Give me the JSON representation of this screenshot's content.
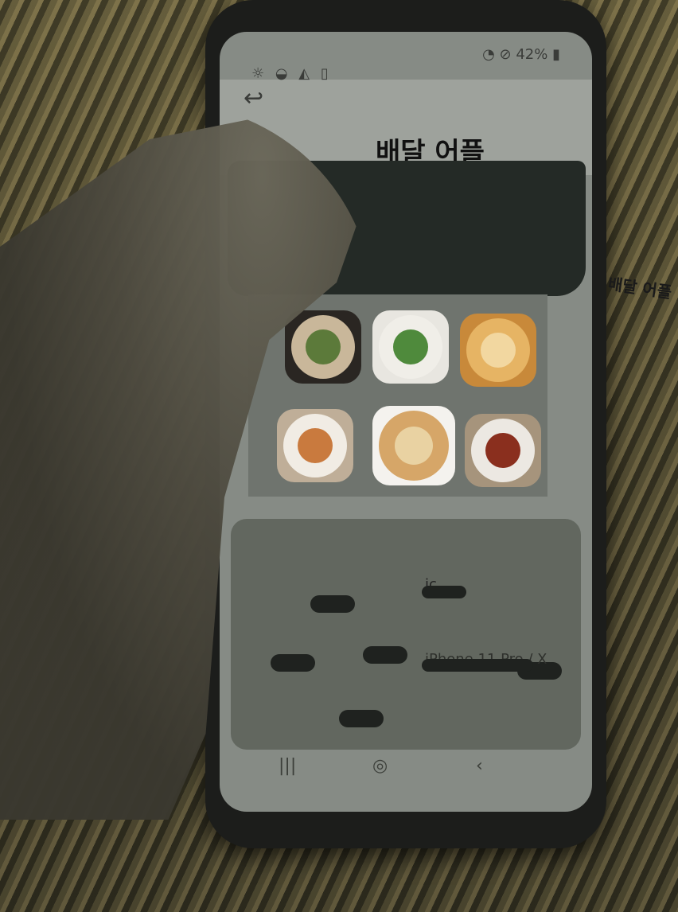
{
  "app": {
    "title": "배달 어플",
    "side_label": "배달 어플"
  },
  "status_bar": {
    "battery": "42%"
  },
  "food_tiles": [
    {
      "name": "hotpot"
    },
    {
      "name": "salad"
    },
    {
      "name": "ramen"
    },
    {
      "name": "brunch-plate"
    },
    {
      "name": "pizza"
    },
    {
      "name": "jjamppong"
    }
  ],
  "info": {
    "caption_top": "ic...",
    "caption_bottom": "iPhone 11 Pro / X"
  },
  "colors": {
    "screen": "#868b85",
    "banner": "#242a26",
    "panel": "#6f746e"
  }
}
